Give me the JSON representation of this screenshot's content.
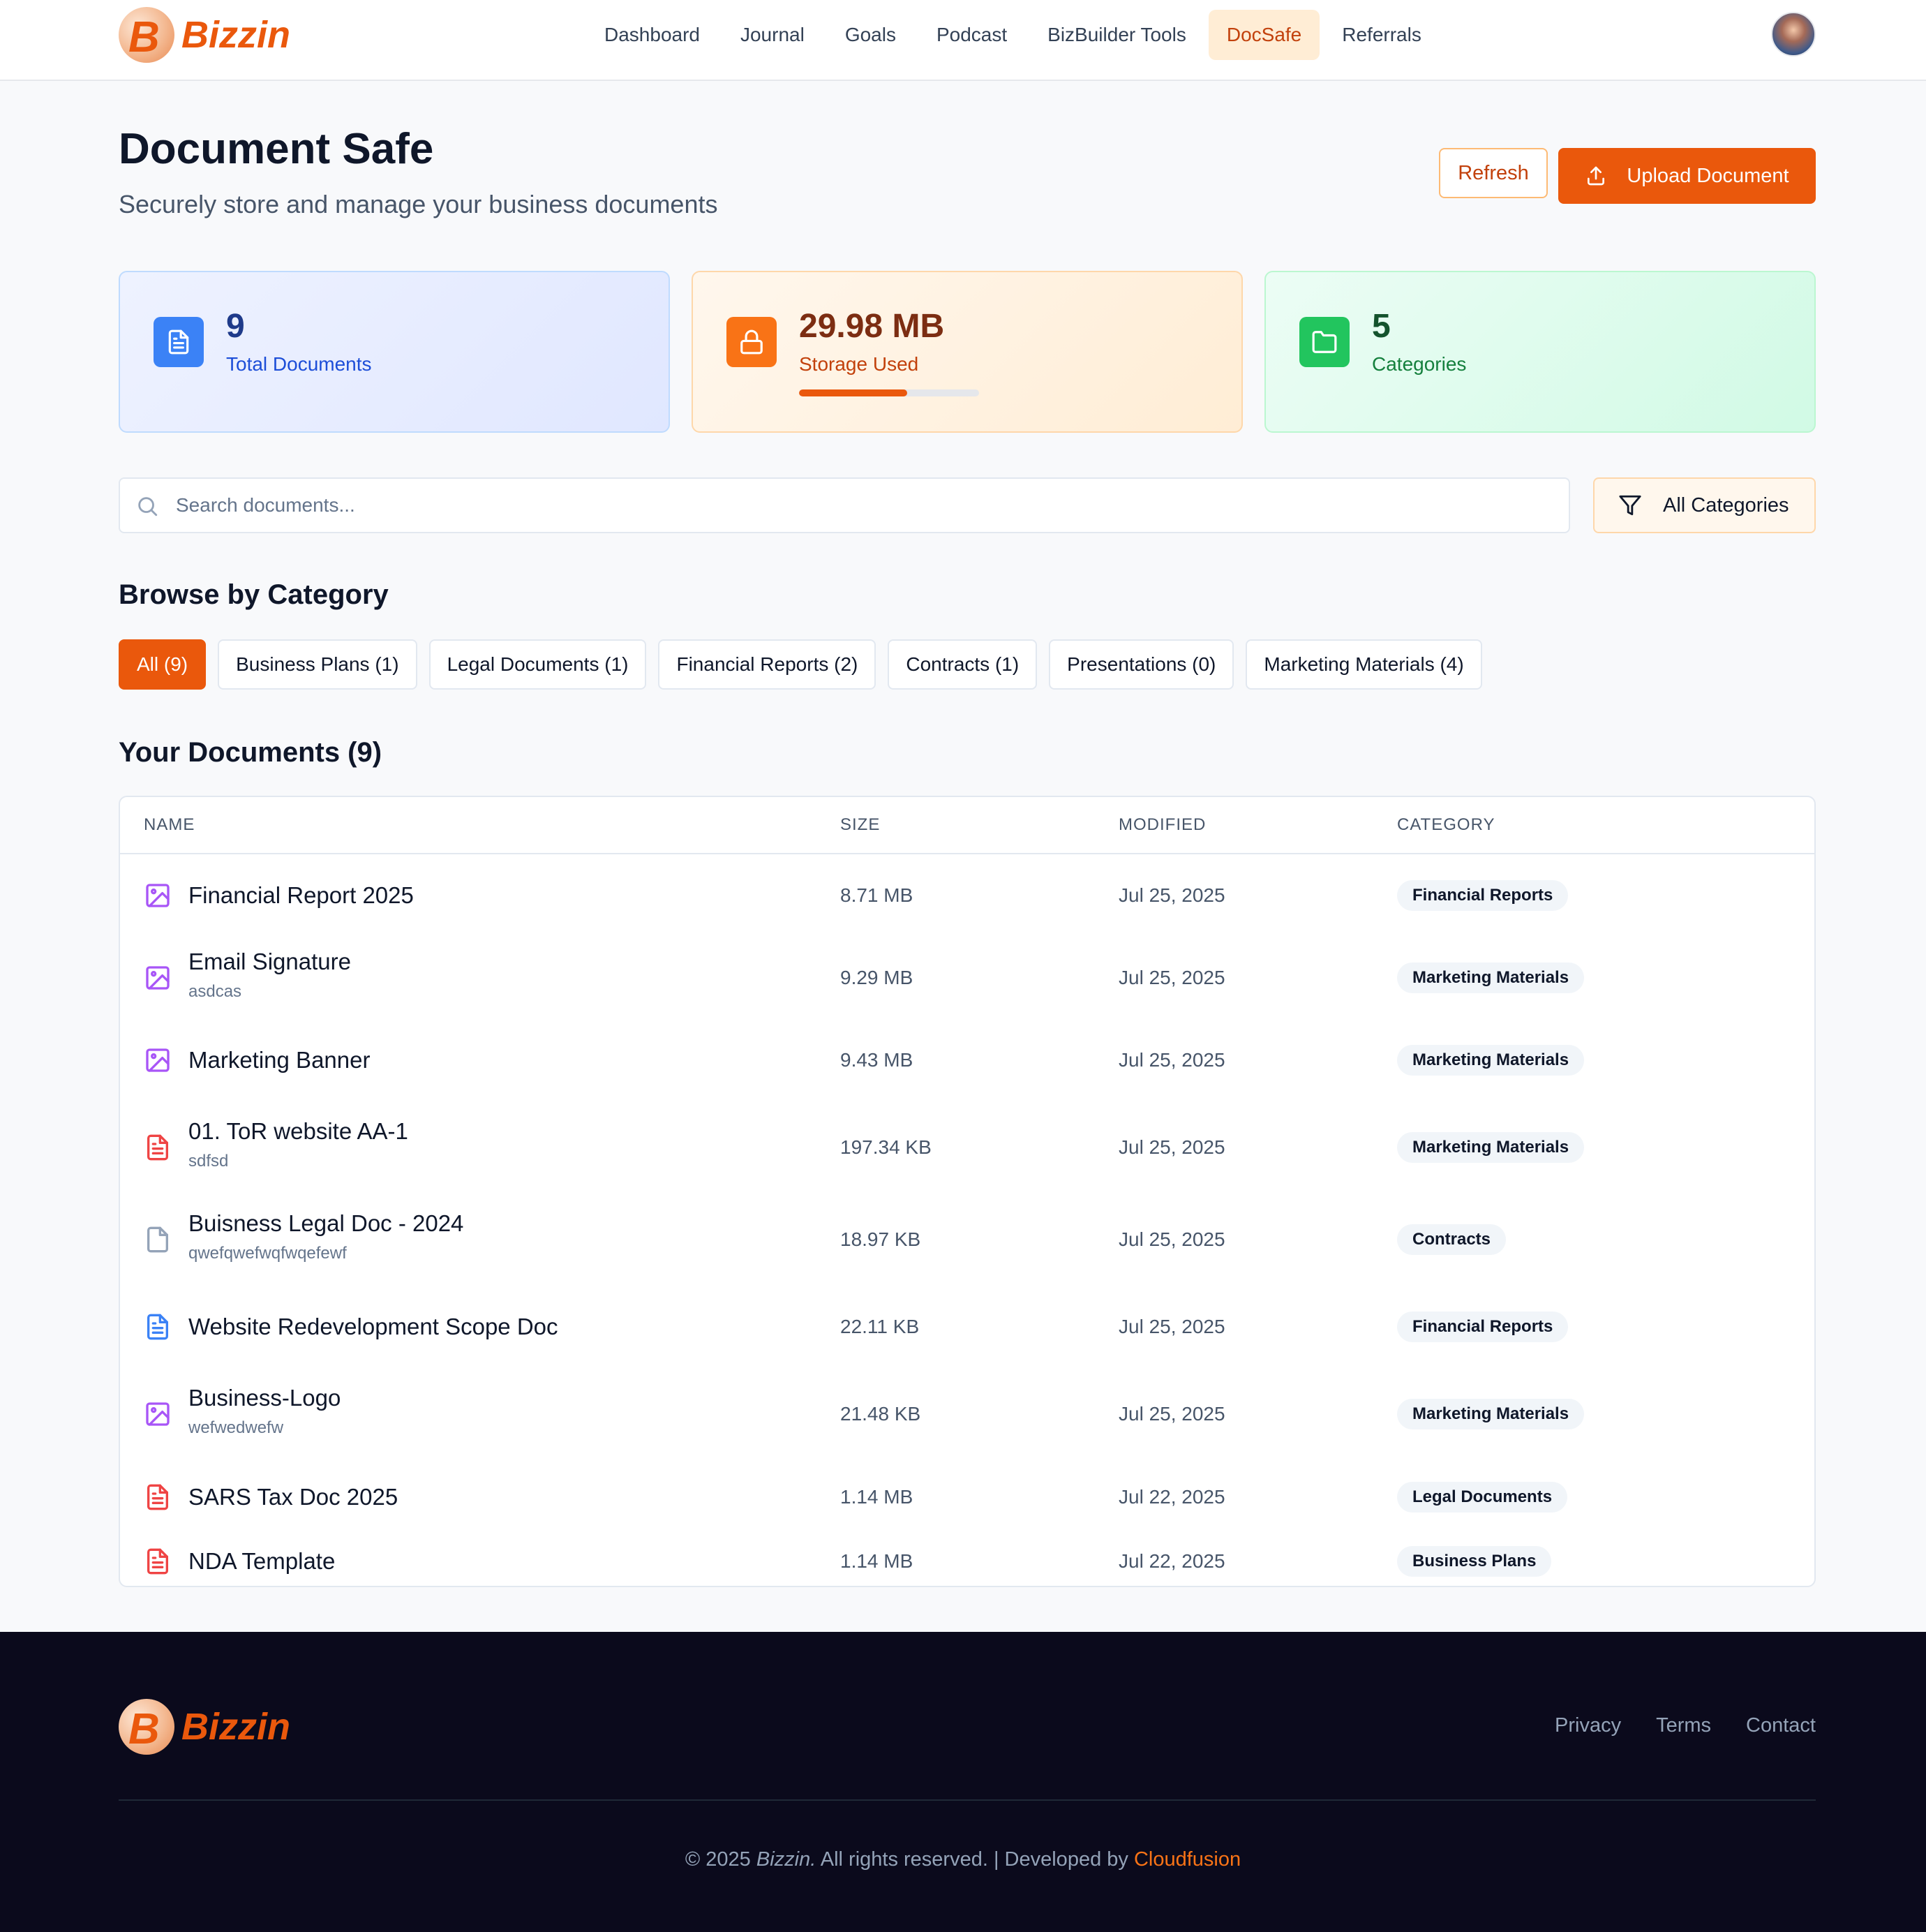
{
  "brand": {
    "name": "Bizzin",
    "mark": "B"
  },
  "nav": {
    "items": [
      {
        "label": "Dashboard",
        "active": false
      },
      {
        "label": "Journal",
        "active": false
      },
      {
        "label": "Goals",
        "active": false
      },
      {
        "label": "Podcast",
        "active": false
      },
      {
        "label": "BizBuilder Tools",
        "active": false
      },
      {
        "label": "DocSafe",
        "active": true
      },
      {
        "label": "Referrals",
        "active": false
      }
    ]
  },
  "header": {
    "title": "Document Safe",
    "subtitle": "Securely store and manage your business documents",
    "refresh_label": "Refresh",
    "upload_label": "Upload Document"
  },
  "stats": {
    "total": {
      "value": "9",
      "label": "Total Documents",
      "icon": "file-text-icon",
      "color": "#3b82f6"
    },
    "storage": {
      "value": "29.98 MB",
      "label": "Storage Used",
      "icon": "lock-icon",
      "color": "#f97316",
      "progress": 0.6
    },
    "categories": {
      "value": "5",
      "label": "Categories",
      "icon": "folder-icon",
      "color": "#22c55e"
    }
  },
  "search": {
    "placeholder": "Search documents...",
    "value": ""
  },
  "filter": {
    "label": "All Categories"
  },
  "browse": {
    "title": "Browse by Category",
    "chips": [
      {
        "label": "All (9)",
        "active": true
      },
      {
        "label": "Business Plans (1)",
        "active": false
      },
      {
        "label": "Legal Documents (1)",
        "active": false
      },
      {
        "label": "Financial Reports (2)",
        "active": false
      },
      {
        "label": "Contracts (1)",
        "active": false
      },
      {
        "label": "Presentations (0)",
        "active": false
      },
      {
        "label": "Marketing Materials (4)",
        "active": false
      }
    ]
  },
  "documents": {
    "title": "Your Documents (9)",
    "columns": {
      "name": "NAME",
      "size": "SIZE",
      "modified": "MODIFIED",
      "category": "CATEGORY"
    },
    "rows": [
      {
        "name": "Financial Report 2025",
        "desc": "",
        "size": "8.71 MB",
        "modified": "Jul 25, 2025",
        "category": "Financial Reports",
        "icon": "image-icon"
      },
      {
        "name": "Email Signature",
        "desc": "asdcas",
        "size": "9.29 MB",
        "modified": "Jul 25, 2025",
        "category": "Marketing Materials",
        "icon": "image-icon"
      },
      {
        "name": "Marketing Banner",
        "desc": "",
        "size": "9.43 MB",
        "modified": "Jul 25, 2025",
        "category": "Marketing Materials",
        "icon": "image-icon"
      },
      {
        "name": "01. ToR website AA-1",
        "desc": "sdfsd",
        "size": "197.34 KB",
        "modified": "Jul 25, 2025",
        "category": "Marketing Materials",
        "icon": "pdf-file-icon"
      },
      {
        "name": "Buisness Legal Doc - 2024",
        "desc": "qwefqwefwqfwqefewf",
        "size": "18.97 KB",
        "modified": "Jul 25, 2025",
        "category": "Contracts",
        "icon": "blank-file-icon"
      },
      {
        "name": "Website Redevelopment Scope Doc",
        "desc": "",
        "size": "22.11 KB",
        "modified": "Jul 25, 2025",
        "category": "Financial Reports",
        "icon": "doc-file-icon"
      },
      {
        "name": "Business-Logo",
        "desc": "wefwedwefw",
        "size": "21.48 KB",
        "modified": "Jul 25, 2025",
        "category": "Marketing Materials",
        "icon": "image-icon"
      },
      {
        "name": "SARS Tax Doc 2025",
        "desc": "",
        "size": "1.14 MB",
        "modified": "Jul 22, 2025",
        "category": "Legal Documents",
        "icon": "pdf-file-icon"
      },
      {
        "name": "NDA Template",
        "desc": "",
        "size": "1.14 MB",
        "modified": "Jul 22, 2025",
        "category": "Business Plans",
        "icon": "pdf-file-icon"
      }
    ]
  },
  "footer": {
    "links": [
      "Privacy",
      "Terms",
      "Contact"
    ],
    "copyright_prefix": "© 2025 ",
    "copyright_brand": "Bizzin.",
    "copyright_middle": " All rights reserved. | Developed by ",
    "developer": "Cloudfusion"
  },
  "colors": {
    "accent": "#ea580c",
    "image_icon": "#a855f7",
    "pdf_icon": "#ef4444",
    "doc_icon": "#3b82f6",
    "blank_icon": "#94a3b8",
    "footer_bg": "#0b0a1c"
  }
}
